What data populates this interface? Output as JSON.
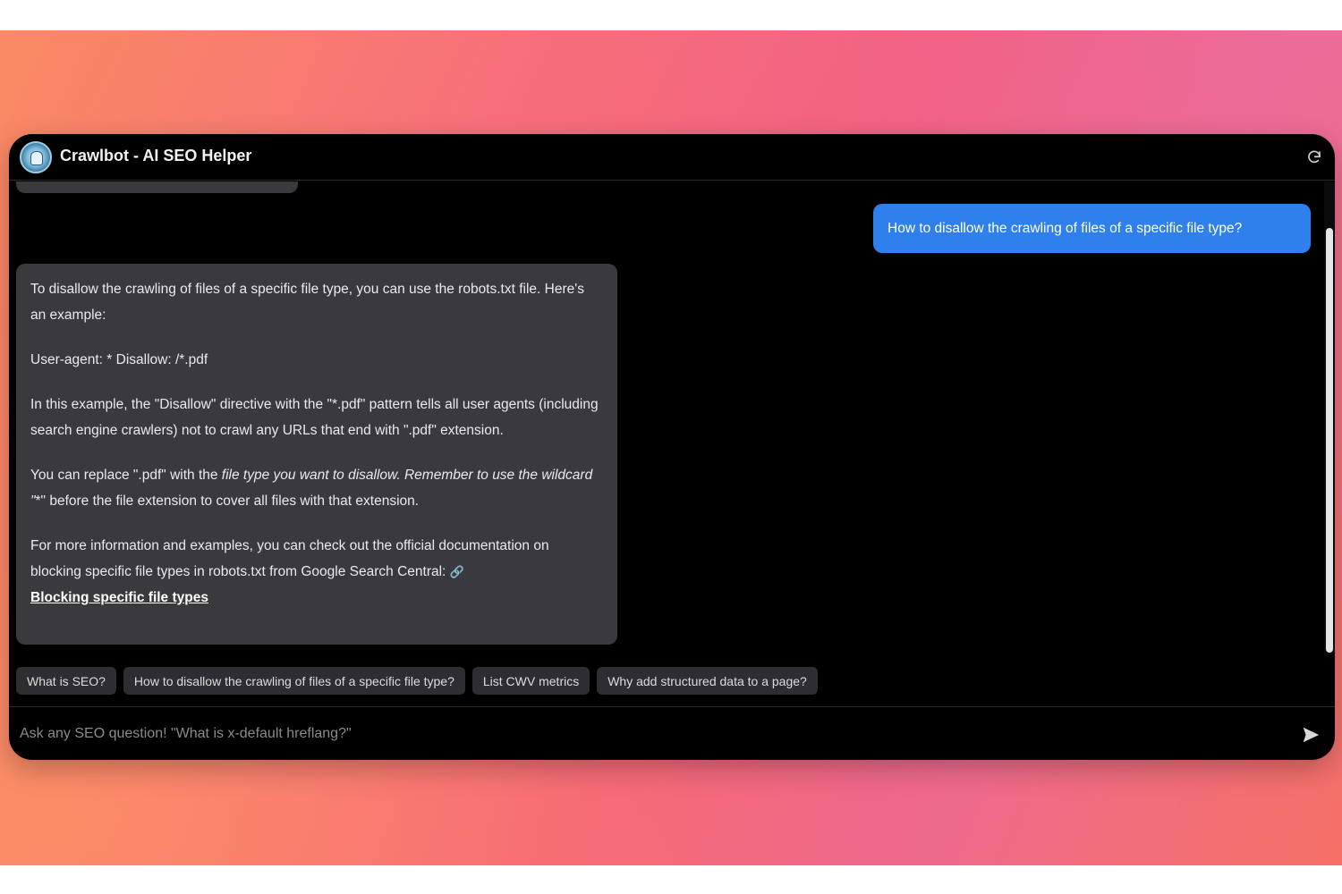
{
  "app": {
    "title": "Crawlbot - AI SEO Helper"
  },
  "chat": {
    "user_message": "How to disallow the crawling of files of a specific file type?",
    "bot_reply": {
      "p1": "To disallow the crawling of files of a specific file type, you can use the robots.txt file. Here's an example:",
      "p2": "User-agent: * Disallow: /*.pdf",
      "p3": "In this example, the \"Disallow\" directive with the \"*.pdf\" pattern tells all user agents (including search engine crawlers) not to crawl any URLs that end with \".pdf\" extension.",
      "p4_a": "You can replace \".pdf\" with the ",
      "p4_b": "file type you want to disallow. Remember to use the wildcard \"",
      "p4_c": "*\" before the file extension to cover all files with that extension.",
      "p5": "For more information and examples, you can check out the official documentation on blocking specific file types in robots.txt from Google Search Central: ",
      "link_icon": "🔗",
      "link_text": "Blocking specific file types"
    }
  },
  "suggestions": [
    "What is SEO?",
    "How to disallow the crawling of files of a specific file type?",
    "List CWV metrics",
    "Why add structured data to a page?"
  ],
  "composer": {
    "placeholder": "Ask any SEO question! \"What is x-default hreflang?\""
  },
  "icons": {
    "refresh": "refresh-icon",
    "send": "send-icon",
    "logo": "crawlbot-logo-icon"
  },
  "colors": {
    "window_bg": "#000000",
    "user_bubble": "#2f80ed",
    "bot_bubble": "#3a3a3e",
    "chip_bg": "#2e2e32"
  }
}
